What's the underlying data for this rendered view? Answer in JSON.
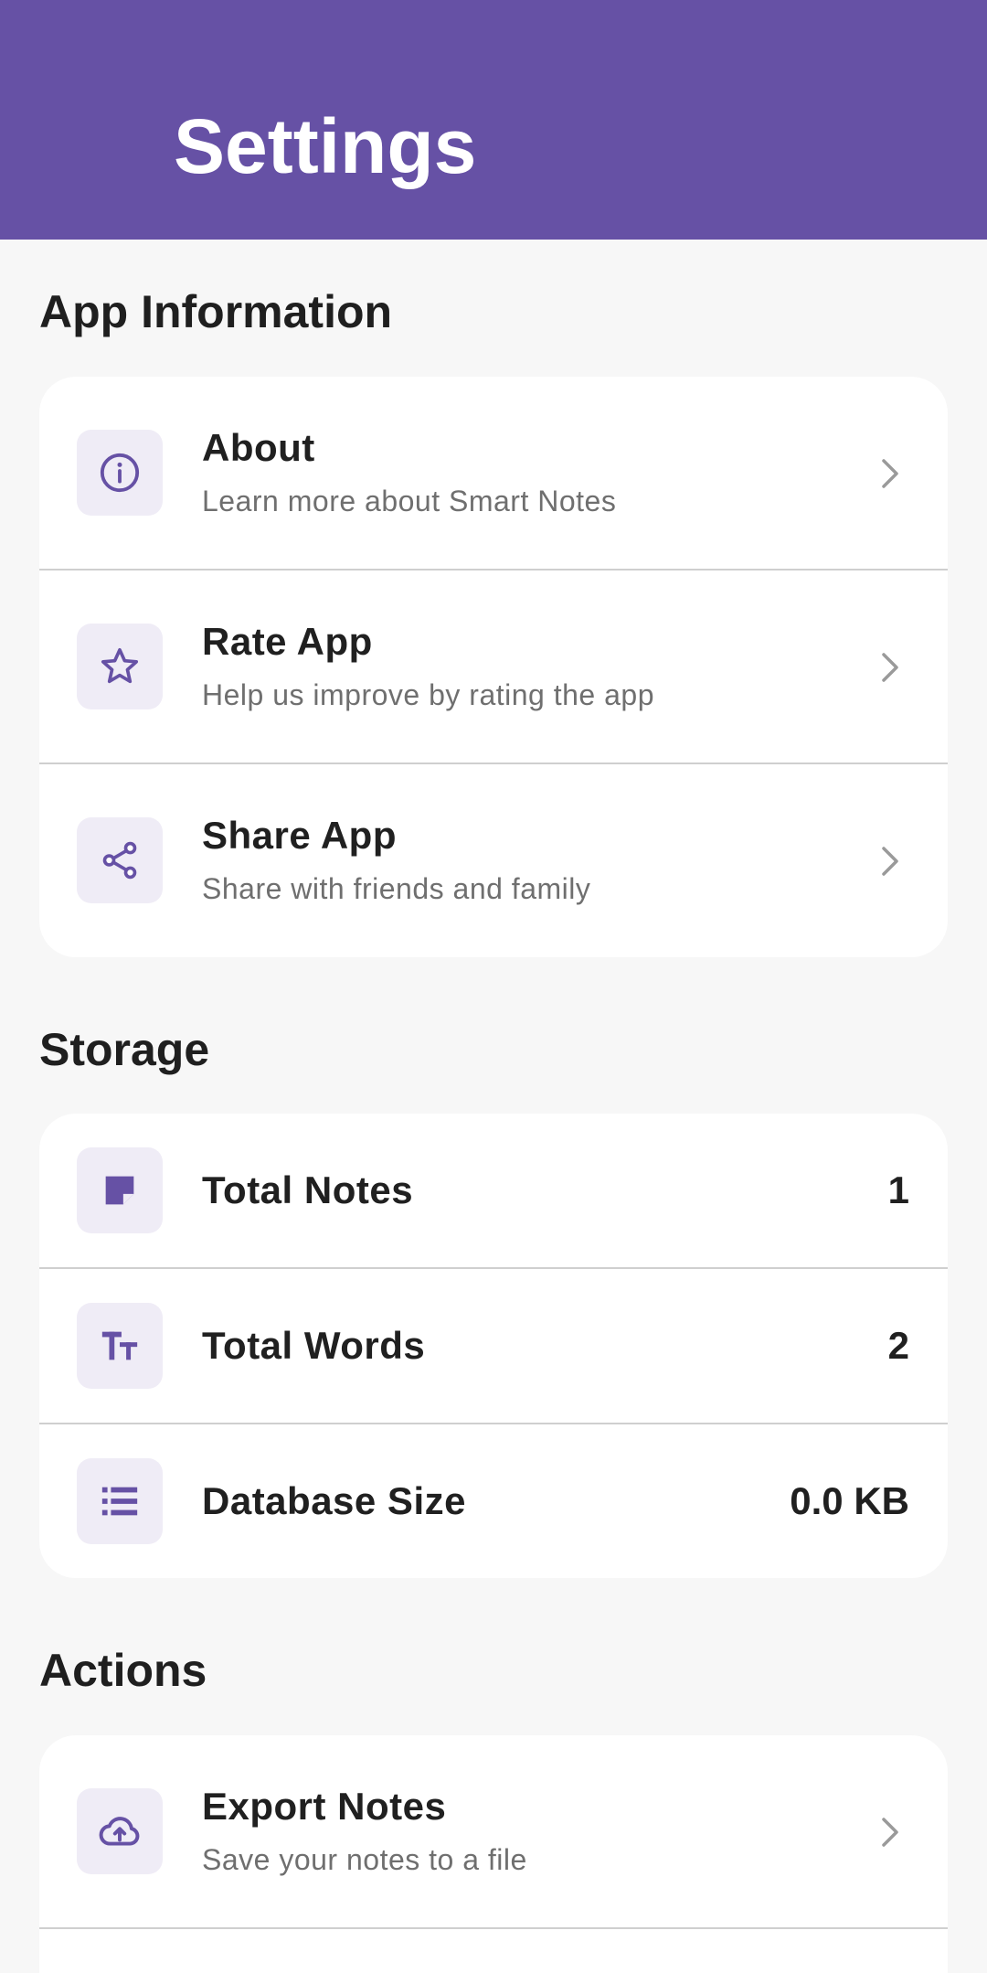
{
  "header": {
    "title": "Settings",
    "background_color": "#6651a5"
  },
  "accent_color": "#6651a5",
  "sections": {
    "app_info": {
      "title": "App Information",
      "items": [
        {
          "title": "About",
          "subtitle": "Learn more about Smart Notes",
          "icon": "info-icon"
        },
        {
          "title": "Rate App",
          "subtitle": "Help us improve by rating the app",
          "icon": "star-icon"
        },
        {
          "title": "Share App",
          "subtitle": "Share with friends and family",
          "icon": "share-icon"
        }
      ]
    },
    "storage": {
      "title": "Storage",
      "items": [
        {
          "title": "Total Notes",
          "value": "1",
          "icon": "note-icon"
        },
        {
          "title": "Total Words",
          "value": "2",
          "icon": "text-size-icon"
        },
        {
          "title": "Database Size",
          "value": "0.0 KB",
          "icon": "storage-list-icon"
        }
      ]
    },
    "actions": {
      "title": "Actions",
      "items": [
        {
          "title": "Export Notes",
          "subtitle": "Save your notes to a file",
          "icon": "cloud-upload-icon"
        }
      ]
    }
  }
}
